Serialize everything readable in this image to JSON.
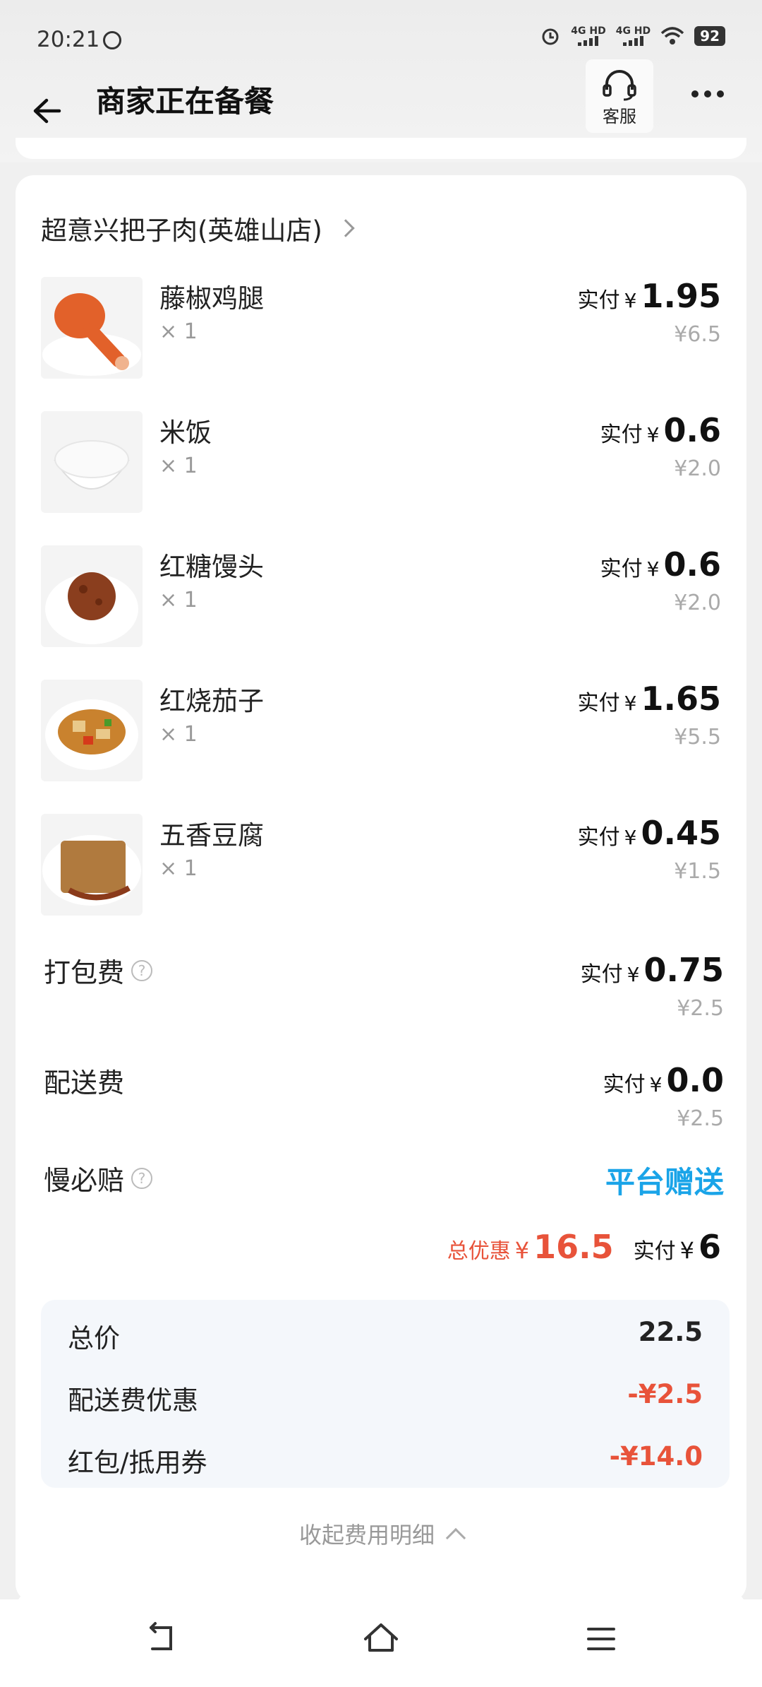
{
  "status_bar": {
    "time": "20:21",
    "network1": "4G HD",
    "network2": "4G HD",
    "battery": "92"
  },
  "header": {
    "title": "商家正在备餐",
    "service_label": "客服"
  },
  "shop": {
    "name": "超意兴把子肉(英雄山店)"
  },
  "items": [
    {
      "name": "藤椒鸡腿",
      "qty": "× 1",
      "pay_label": "实付",
      "currency": "¥",
      "paid": "1.95",
      "original": "¥6.5"
    },
    {
      "name": "米饭",
      "qty": "× 1",
      "pay_label": "实付",
      "currency": "¥",
      "paid": "0.6",
      "original": "¥2.0"
    },
    {
      "name": "红糖馒头",
      "qty": "× 1",
      "pay_label": "实付",
      "currency": "¥",
      "paid": "0.6",
      "original": "¥2.0"
    },
    {
      "name": "红烧茄子",
      "qty": "× 1",
      "pay_label": "实付",
      "currency": "¥",
      "paid": "1.65",
      "original": "¥5.5"
    },
    {
      "name": "五香豆腐",
      "qty": "× 1",
      "pay_label": "实付",
      "currency": "¥",
      "paid": "0.45",
      "original": "¥1.5"
    }
  ],
  "fees": {
    "packing": {
      "name": "打包费",
      "pay_label": "实付",
      "currency": "¥",
      "paid": "0.75",
      "original": "¥2.5"
    },
    "delivery": {
      "name": "配送费",
      "pay_label": "实付",
      "currency": "¥",
      "paid": "0.0",
      "original": "¥2.5"
    },
    "late_comp": {
      "name": "慢必赔",
      "value": "平台赠送"
    }
  },
  "summary": {
    "discount_label": "总优惠",
    "discount_currency": "¥",
    "discount": "16.5",
    "paid_label": "实付",
    "paid_currency": "¥",
    "paid": "6"
  },
  "breakdown": {
    "total_label": "总价",
    "total": "22.5",
    "delivery_discount_label": "配送费优惠",
    "delivery_discount": "-¥2.5",
    "coupon_label": "红包/抵用券",
    "coupon": "-¥14.0"
  },
  "collapse_label": "收起费用明细",
  "colors": {
    "accent_blue": "#1aa4e8",
    "discount_red": "#e8533a"
  }
}
